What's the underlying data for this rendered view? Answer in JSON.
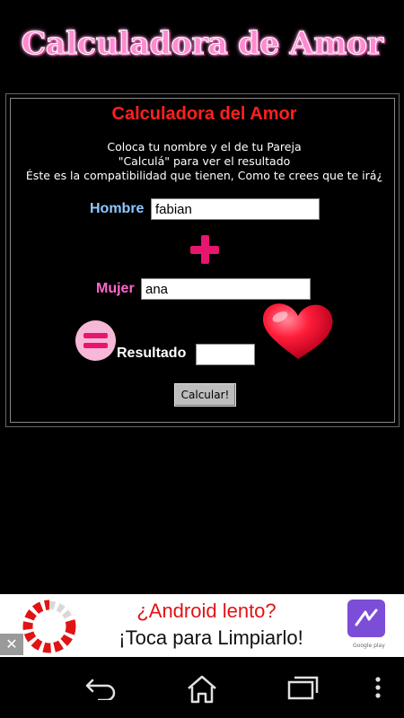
{
  "app": {
    "title": "Calculadora de Amor"
  },
  "form": {
    "heading": "Calculadora del Amor",
    "instructions": [
      "Coloca tu nombre y el de tu Pareja",
      "\"Calculá\" para ver el resultado",
      "Éste es la compatibilidad que tienen, Como te crees que te irá¿"
    ],
    "name_label": "Hombre",
    "name_value": "fabian",
    "partner_label": "Mujer",
    "partner_value": "ana",
    "result_label": "Resultado",
    "result_value": "",
    "calculate_button": "Calcular!"
  },
  "ad": {
    "line1": "¿Android lento?",
    "line2": "¡Toca para Limpiarlo!",
    "close": "✕",
    "store_badge": "Google play",
    "colors": {
      "headline": "#e01414",
      "ring": "#e01414"
    }
  },
  "colors": {
    "title": "#ff8ad0",
    "heading": "#ff2020",
    "hombre_label": "#8fc8ff",
    "mujer_label": "#ff66cc",
    "plus_sign": "#e8156f",
    "heart": "#ff1d3a"
  },
  "icons": {
    "plus": "plus-icon",
    "equals": "equals-icon",
    "heart": "heart-icon",
    "back": "back-icon",
    "home": "home-icon",
    "recents": "recents-icon",
    "menu": "overflow-menu-icon"
  }
}
